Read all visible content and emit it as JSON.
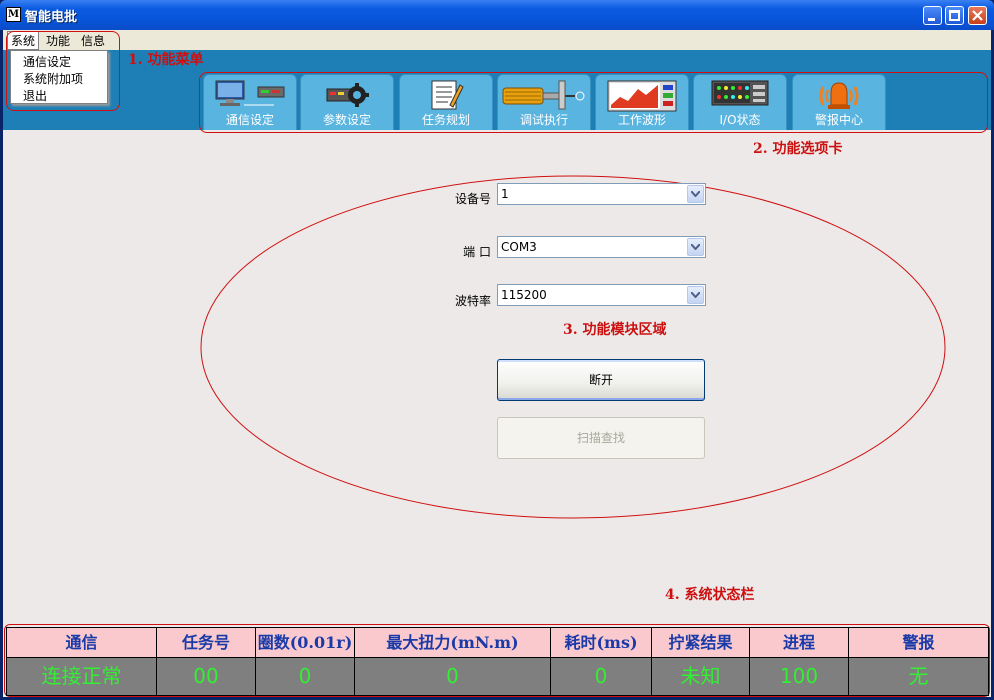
{
  "window": {
    "title": "智能电批",
    "icon_text": "M"
  },
  "menu": {
    "items": [
      "系统",
      "功能",
      "信息"
    ],
    "dropdown": [
      "通信设定",
      "系统附加项",
      "退出"
    ]
  },
  "tabs": [
    {
      "label": "通信设定",
      "icon": "computer-network-icon"
    },
    {
      "label": "参数设定",
      "icon": "gear-device-icon"
    },
    {
      "label": "任务规划",
      "icon": "document-edit-icon"
    },
    {
      "label": "调试执行",
      "icon": "screwdriver-icon"
    },
    {
      "label": "工作波形",
      "icon": "waveform-monitor-icon"
    },
    {
      "label": "I/O状态",
      "icon": "io-panel-icon"
    },
    {
      "label": "警报中心",
      "icon": "alarm-bell-icon"
    }
  ],
  "annotations": {
    "menu": "1. 功能菜单",
    "tabs": "2. 功能选项卡",
    "module": "3. 功能模块区域",
    "status": "4. 系统状态栏"
  },
  "form": {
    "device_label": "设备号",
    "device_value": "1",
    "port_label": "端 口",
    "port_value": "COM3",
    "baud_label": "波特率",
    "baud_value": "115200",
    "disconnect_label": "断开",
    "scan_label": "扫描查找"
  },
  "status_bar": {
    "headers": [
      "通信",
      "任务号",
      "圈数(0.01r)",
      "最大扭力(mN.m)",
      "耗时(ms)",
      "拧紧结果",
      "进程",
      "警报"
    ],
    "values": [
      "连接正常",
      "00",
      "0",
      "0",
      "0",
      "未知",
      "100",
      "无"
    ]
  },
  "colors": {
    "tab_band": "#1e7fb6",
    "tab_bg": "#5ab4e0",
    "annotation": "#cc1010",
    "status_header_bg": "#fac9ce",
    "status_header_text": "#1a3aa8",
    "status_value_bg": "#7f7f7f",
    "status_value_text": "#33ee33"
  }
}
